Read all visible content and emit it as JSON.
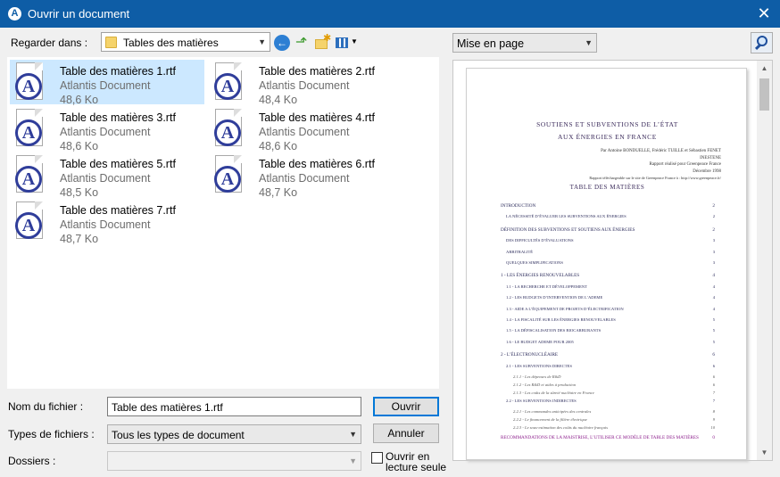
{
  "window": {
    "title": "Ouvrir un document",
    "close_glyph": "✕",
    "app_icon_letter": "A"
  },
  "look_in": {
    "label": "Regarder dans :",
    "value": "Tables des matières"
  },
  "files": [
    {
      "name": "Table des matières 1.rtf",
      "type": "Atlantis Document",
      "size": "48,6 Ko",
      "selected": true
    },
    {
      "name": "Table des matières 2.rtf",
      "type": "Atlantis Document",
      "size": "48,4 Ko"
    },
    {
      "name": "Table des matières 3.rtf",
      "type": "Atlantis Document",
      "size": "48,6 Ko"
    },
    {
      "name": "Table des matières 4.rtf",
      "type": "Atlantis Document",
      "size": "48,6 Ko"
    },
    {
      "name": "Table des matières 5.rtf",
      "type": "Atlantis Document",
      "size": "48,5 Ko"
    },
    {
      "name": "Table des matières 6.rtf",
      "type": "Atlantis Document",
      "size": "48,7 Ko"
    },
    {
      "name": "Table des matières 7.rtf",
      "type": "Atlantis Document",
      "size": "48,7 Ko"
    }
  ],
  "file_name": {
    "label": "Nom du fichier :",
    "value": "Table des matières 1.rtf"
  },
  "file_types": {
    "label": "Types de fichiers :",
    "value": "Tous les types de document"
  },
  "folders": {
    "label": "Dossiers :",
    "value": ""
  },
  "buttons": {
    "open": "Ouvrir",
    "cancel": "Annuler"
  },
  "read_only": {
    "label": "Ouvrir en lecture seule",
    "checked": false
  },
  "preview_mode": {
    "value": "Mise en page"
  },
  "preview": {
    "title_line1": "SOUTIENS ET SUBVENTIONS DE L’ÉTAT",
    "title_line2": "AUX ÉNERGIES EN FRANCE",
    "meta": [
      "Par Antoine BONDUELLE, Frédéric TUILLE et Sébastien FENET",
      "INESTENE",
      "Rapport réalisé pour Greenpeace France",
      "Décembre 1998",
      "Rapport téléchargeable sur le site de Greenpeace France à : http://www.greenpeace.fr/"
    ],
    "toc_heading": "TABLE DES MATIÈRES",
    "toc": [
      {
        "text": "INTRODUCTION",
        "page": "2",
        "level": 1
      },
      {
        "text": "LA NÉCESSITÉ D’ÉVALUER LES SUBVENTIONS AUX ÉNERGIES",
        "page": "2",
        "level": 2
      },
      {
        "text": "DÉFINITION DES SUBVENTIONS ET SOUTIENS AUX ÉNERGIES",
        "page": "2",
        "level": 1
      },
      {
        "text": "DES DIFFICULTÉS D’ÉVALUATIONS",
        "page": "3",
        "level": 2
      },
      {
        "text": "ARBITRALITÉ",
        "page": "3",
        "level": 2
      },
      {
        "text": "QUELQUES SIMPLIFICATIONS",
        "page": "3",
        "level": 2
      },
      {
        "text": "1 - LES ÉNERGIES RENOUVELABLES",
        "page": "4",
        "level": 1
      },
      {
        "text": "1.1 - LA RECHERCHE ET DÉVELOPPEMENT",
        "page": "4",
        "level": 2
      },
      {
        "text": "1.2 - LES BUDGETS D’INTERVENTION DE L’ADEME",
        "page": "4",
        "level": 2
      },
      {
        "text": "1.3 - AIDE A L’ÉQUIPEMENT DE PROJETS D’ÉLECTRIFICATION",
        "page": "4",
        "level": 2
      },
      {
        "text": "1.4 - LA FISCALITÉ SUR LES ÉNERGIES RENOUVELABLES",
        "page": "5",
        "level": 2
      },
      {
        "text": "1.5 - LA DÉFISCALISATION DES BIOCARBURANTS",
        "page": "5",
        "level": 2
      },
      {
        "text": "1.6 - LE BUDGET ADEME POUR 2005",
        "page": "5",
        "level": 2
      },
      {
        "text": "2 - L’ÉLECTRONUCLÉAIRE",
        "page": "6",
        "level": 1
      },
      {
        "text": "2.1 - LES SUBVENTIONS DIRECTES",
        "page": "6",
        "level": 2
      },
      {
        "text": "2.1.1 - Les dépenses de R&D",
        "page": "6",
        "level": 3
      },
      {
        "text": "2.1.2 - Les R&D et aides à production",
        "page": "6",
        "level": 3
      },
      {
        "text": "2.1.3 - Les coûts de la sûreté nucléaire en France",
        "page": "7",
        "level": 3
      },
      {
        "text": "2.2 - LES SUBVENTIONS INDIRECTES",
        "page": "7",
        "level": 2
      },
      {
        "text": "2.2.1 - Les commandes anticipées des centrales",
        "page": "8",
        "level": 3
      },
      {
        "text": "2.2.2 - Le financement de la filière électrique",
        "page": "9",
        "level": 3
      },
      {
        "text": "2.2.3 - Le sous-estimation des coûts du nucléaire français",
        "page": "10",
        "level": 3
      },
      {
        "text": "RECOMMANDATIONS DE LA MAISTRISE, L’UTILISER CE MODÈLE DE TABLE DES MATIÈRES",
        "page": "0",
        "level": 1,
        "purple": true
      }
    ]
  }
}
